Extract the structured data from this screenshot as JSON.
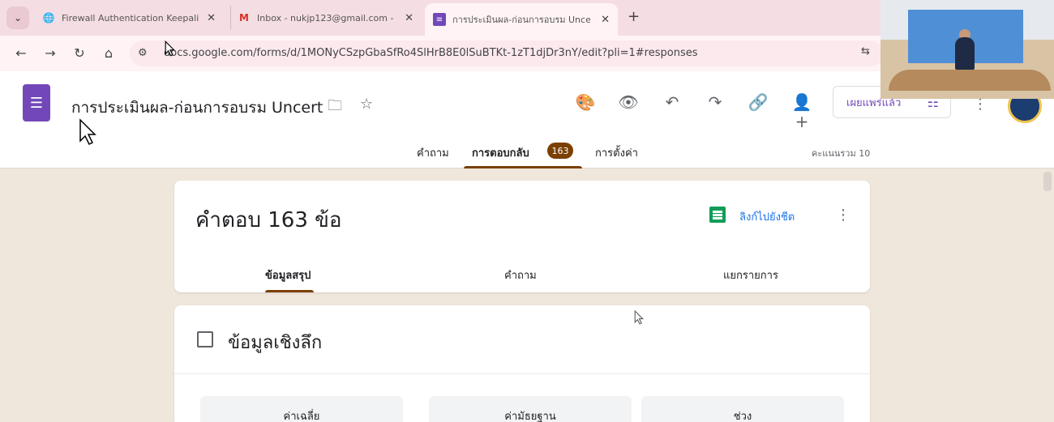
{
  "browser": {
    "tabs": [
      {
        "title": "Firewall Authentication Keepali",
        "icon": "globe-icon"
      },
      {
        "title": "Inbox - nukjp123@gmail.com -",
        "icon": "gmail-icon"
      },
      {
        "title": "การประเมินผล-ก่อนการอบรม Uncer",
        "icon": "forms-icon"
      }
    ],
    "url": "docs.google.com/forms/d/1MONyCSzpGbaSfRo4SlHrB8E0lSuBTKt-1zT1djDr3nY/edit?pli=1#responses"
  },
  "form": {
    "title": "การประเมินผล-ก่อนการอบรม Uncerta",
    "publish_label": "เผยแพร่แล้ว",
    "tabs": {
      "questions": "คำถาม",
      "responses": "การตอบกลับ",
      "settings": "การตั้งค่า"
    },
    "response_count": "163",
    "total_points": "คะแนนรวม 10"
  },
  "responses": {
    "title": "คำตอบ 163 ข้อ",
    "sheet_link": "ลิงก์ไปยังชีต",
    "subtabs": {
      "summary": "ข้อมูลสรุป",
      "question": "คำถาม",
      "individual": "แยกรายการ"
    }
  },
  "insights": {
    "title": "ข้อมูลเชิงลึก",
    "stats": [
      "ค่าเฉลี่ย",
      "ค่ามัธยฐาน",
      "ช่วง"
    ]
  }
}
